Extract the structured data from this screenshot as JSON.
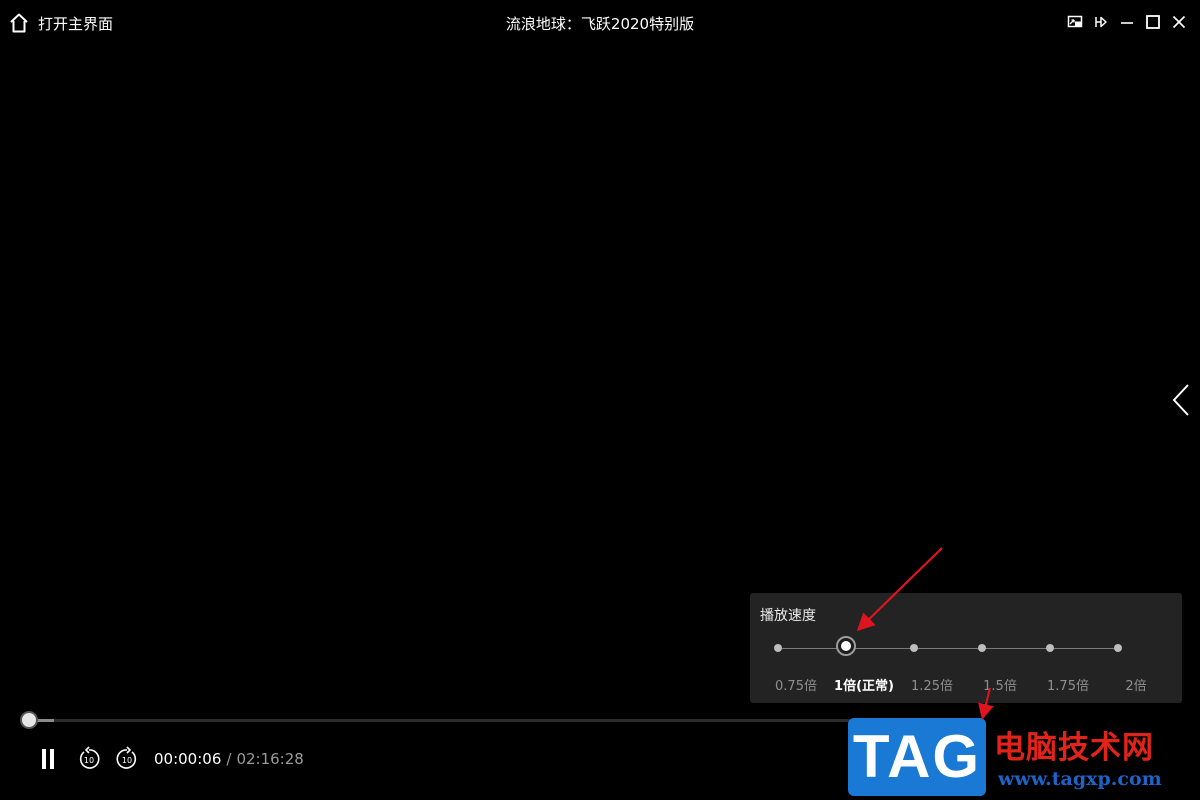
{
  "header": {
    "home_label": "打开主界面",
    "title": "流浪地球：飞跃2020特别版",
    "home_icon": "home-icon",
    "window_buttons": [
      "picture-in-picture-icon",
      "pin-icon",
      "minimize-icon",
      "maximize-icon",
      "close-icon"
    ]
  },
  "player": {
    "current_time": "00:00:06",
    "separator": "/",
    "total_time": "02:16:28",
    "progress": 0.0073,
    "pause_icon": "pause-icon",
    "rewind_label": "10",
    "forward_label": "10"
  },
  "speed": {
    "title": "播放速度",
    "options": [
      {
        "label": "0.75倍",
        "selected": false
      },
      {
        "label": "1倍(正常)",
        "selected": true
      },
      {
        "label": "1.25倍",
        "selected": false
      },
      {
        "label": "1.5倍",
        "selected": false
      },
      {
        "label": "1.75倍",
        "selected": false
      },
      {
        "label": "2倍",
        "selected": false
      }
    ]
  },
  "watermark": {
    "tag": "TAG",
    "brand": "电脑技术网",
    "url": "www.tagxp.com"
  },
  "colors": {
    "background": "#000000",
    "panel": "#232323",
    "annotation_red": "#e0141e",
    "tag_blue": "#1979d4"
  }
}
